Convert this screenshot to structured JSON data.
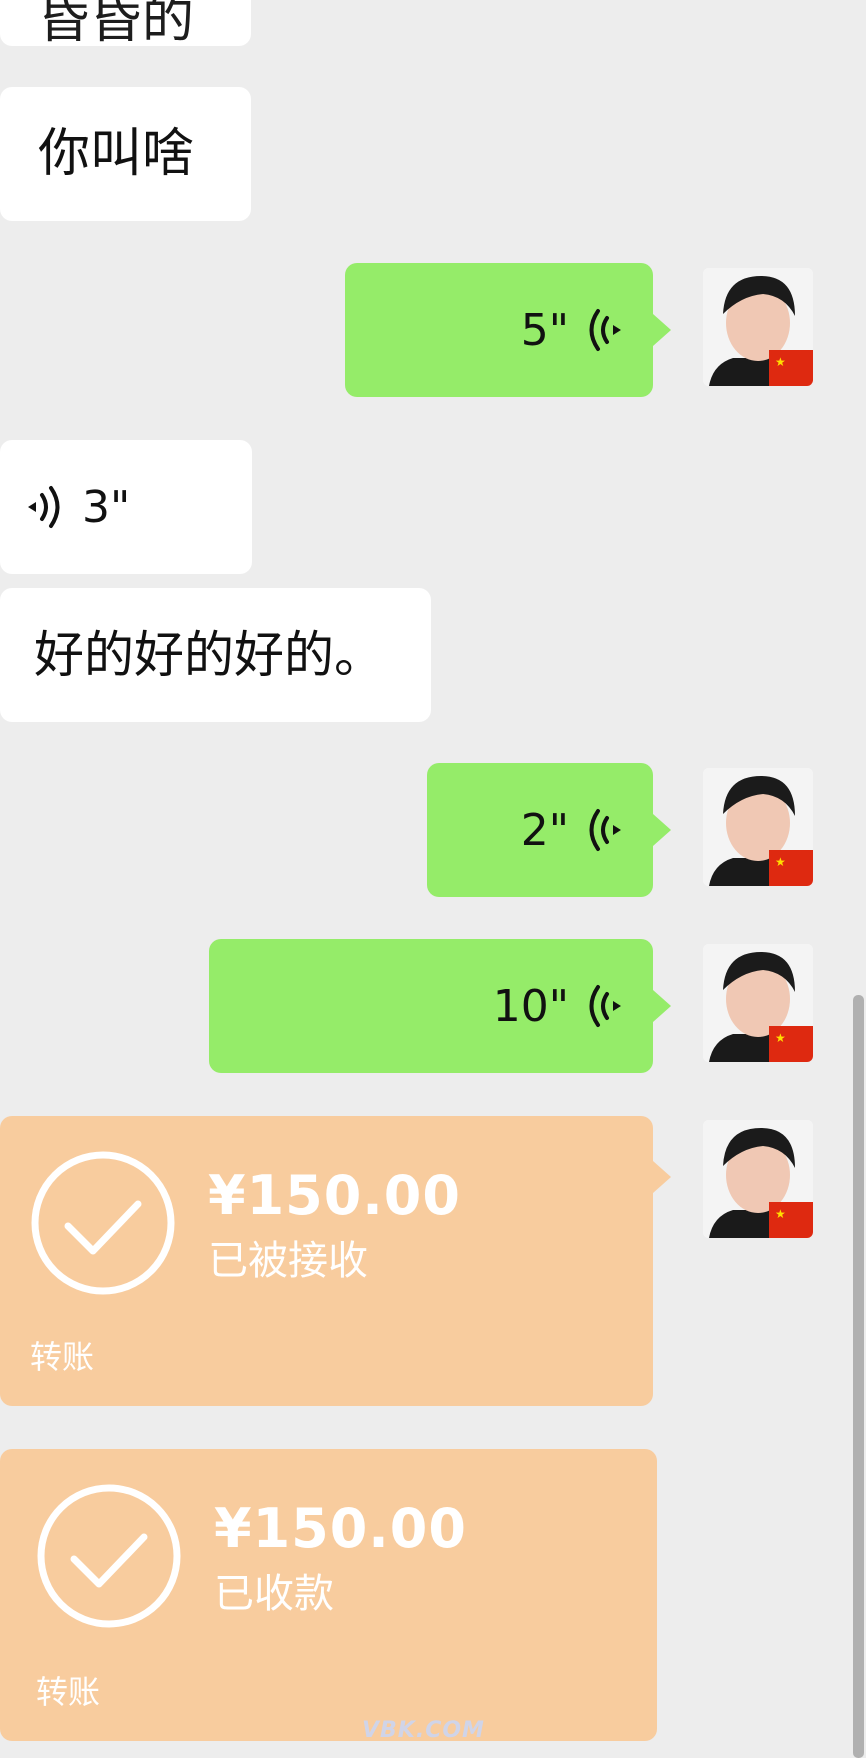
{
  "messages": {
    "top_partial": "昏昏的",
    "m1_text": "你叫啥",
    "m2_voice_out": "5\"",
    "m3_voice_in": "3\"",
    "m4_text": "好的好的好的。",
    "m5_voice_out": "2\"",
    "m6_voice_out": "10\""
  },
  "transfer1": {
    "amount": "¥150.00",
    "status": "已被接收",
    "label": "转账"
  },
  "transfer2": {
    "amount": "¥150.00",
    "status": "已收款",
    "label": "转账"
  },
  "watermark": "VBK.COM",
  "colors": {
    "background": "#ededed",
    "incoming_bubble": "#ffffff",
    "outgoing_bubble": "#95ec69",
    "transfer_bubble": "#f8cc9e"
  },
  "icons": [
    "voice-wave-icon",
    "check-circle-icon",
    "china-flag-icon",
    "avatar"
  ]
}
